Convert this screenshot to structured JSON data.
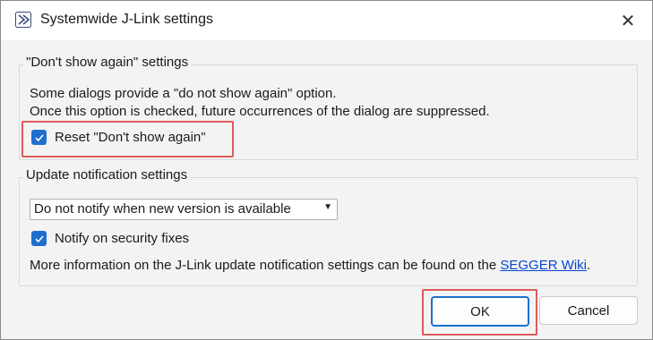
{
  "window": {
    "title": "Systemwide J-Link settings"
  },
  "group_dont_show": {
    "label": "\"Don't show again\" settings",
    "line1": "Some dialogs provide a \"do not show again\" option.",
    "line2": "Once this option is checked, future occurrences of the dialog are suppressed.",
    "reset_checkbox": {
      "label": "Reset \"Don't show again\"",
      "checked": true
    }
  },
  "group_update": {
    "label": "Update notification settings",
    "dropdown_value": "Do not notify when new version is available",
    "security_checkbox": {
      "label": "Notify on security fixes",
      "checked": true
    },
    "info_prefix": "More information on the J-Link update notification settings can be found on the ",
    "info_link": "SEGGER Wiki",
    "info_suffix": "."
  },
  "buttons": {
    "ok": "OK",
    "cancel": "Cancel"
  },
  "colors": {
    "accent": "#1f6fcf",
    "highlight": "#e05a5a",
    "link": "#0645d1"
  }
}
